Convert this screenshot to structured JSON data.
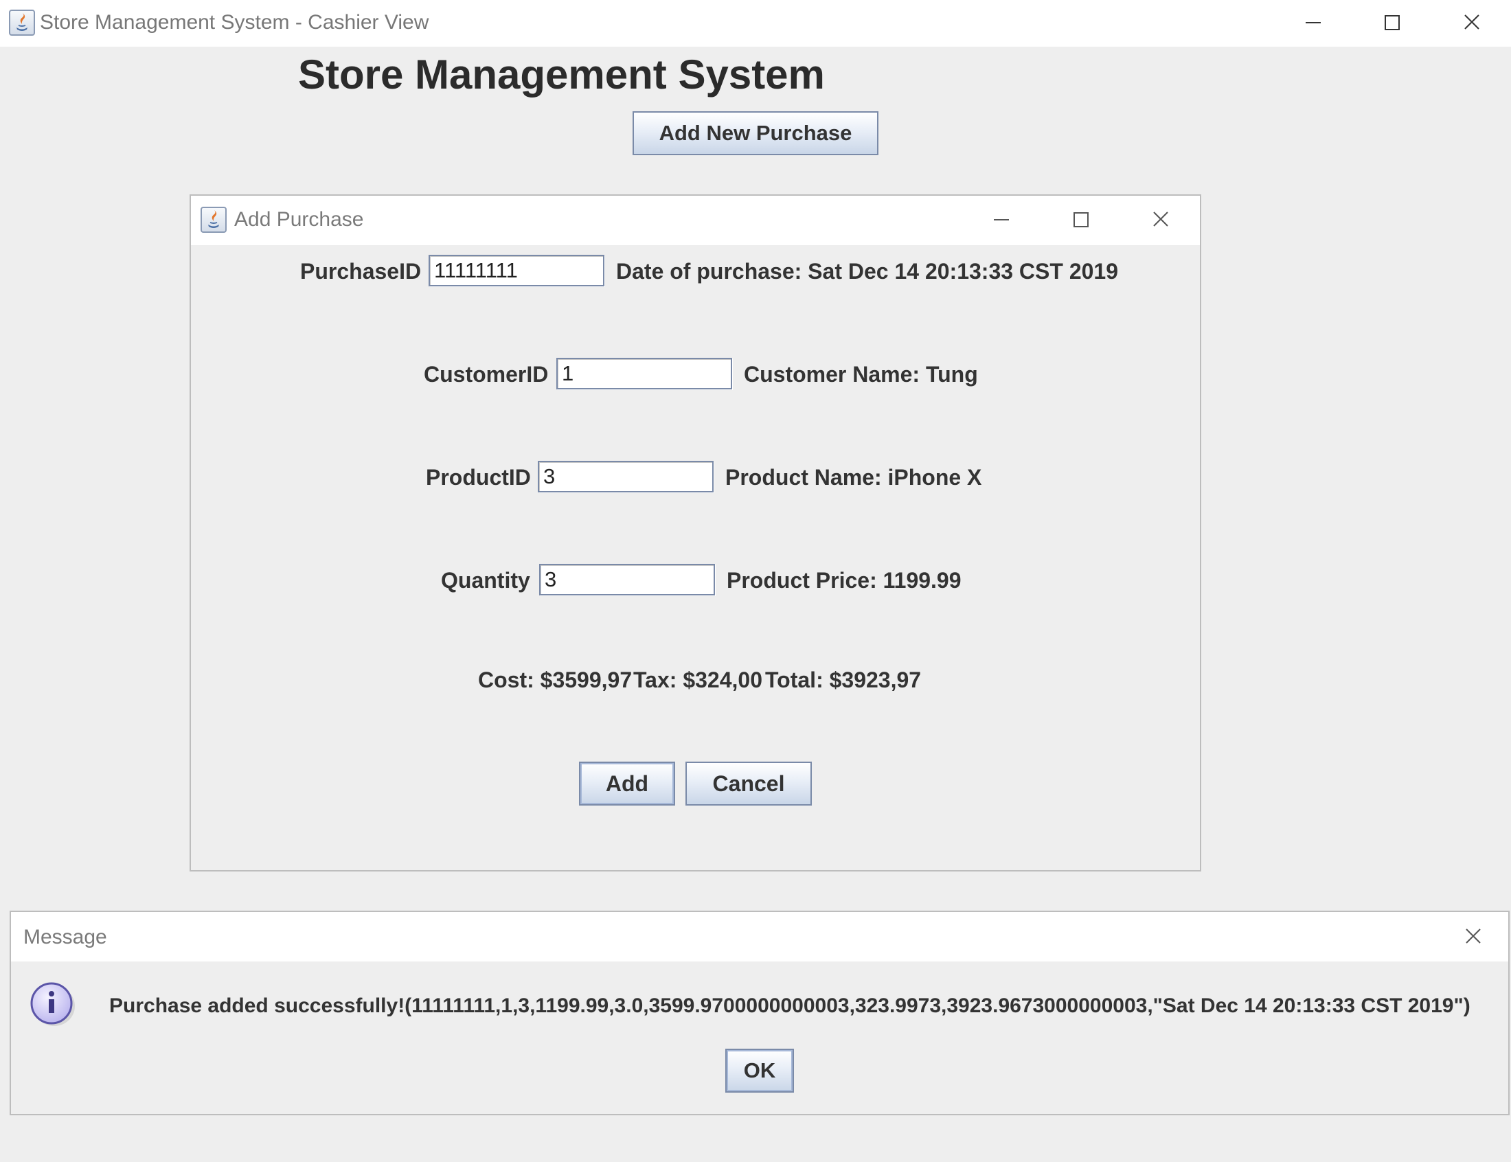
{
  "main_window": {
    "title": "Store Management System - Cashier View",
    "heading": "Store Management System",
    "add_new_purchase_label": "Add New Purchase"
  },
  "add_purchase_dialog": {
    "title": "Add Purchase",
    "purchase_id_label": "PurchaseID",
    "purchase_id_value": "11111111",
    "date_label": "Date of purchase: Sat Dec 14 20:13:33 CST 2019",
    "customer_id_label": "CustomerID",
    "customer_id_value": "1",
    "customer_name_label": "Customer Name: Tung",
    "product_id_label": "ProductID",
    "product_id_value": "3",
    "product_name_label": "Product Name: iPhone X",
    "quantity_label": "Quantity",
    "quantity_value": "3",
    "product_price_label": "Product Price: 1199.99",
    "cost_label": "Cost: $3599,97",
    "tax_label": "Tax: $324,00",
    "total_label": "Total: $3923,97",
    "add_label": "Add",
    "cancel_label": "Cancel"
  },
  "message_dialog": {
    "title": "Message",
    "icon": "info-icon",
    "message": "Purchase added successfully!(11111111,1,3,1199.99,3.0,3599.9700000000003,323.9973,3923.9673000000003,\"Sat Dec 14 20:13:33 CST 2019\")",
    "ok_label": "OK"
  },
  "colors": {
    "background": "#eeeeee",
    "titlebar": "#ffffff",
    "button_border": "#7a8aa8",
    "button_gradient_top": "#ffffff",
    "button_gradient_bottom": "#c9d6e8",
    "text": "#333333"
  }
}
